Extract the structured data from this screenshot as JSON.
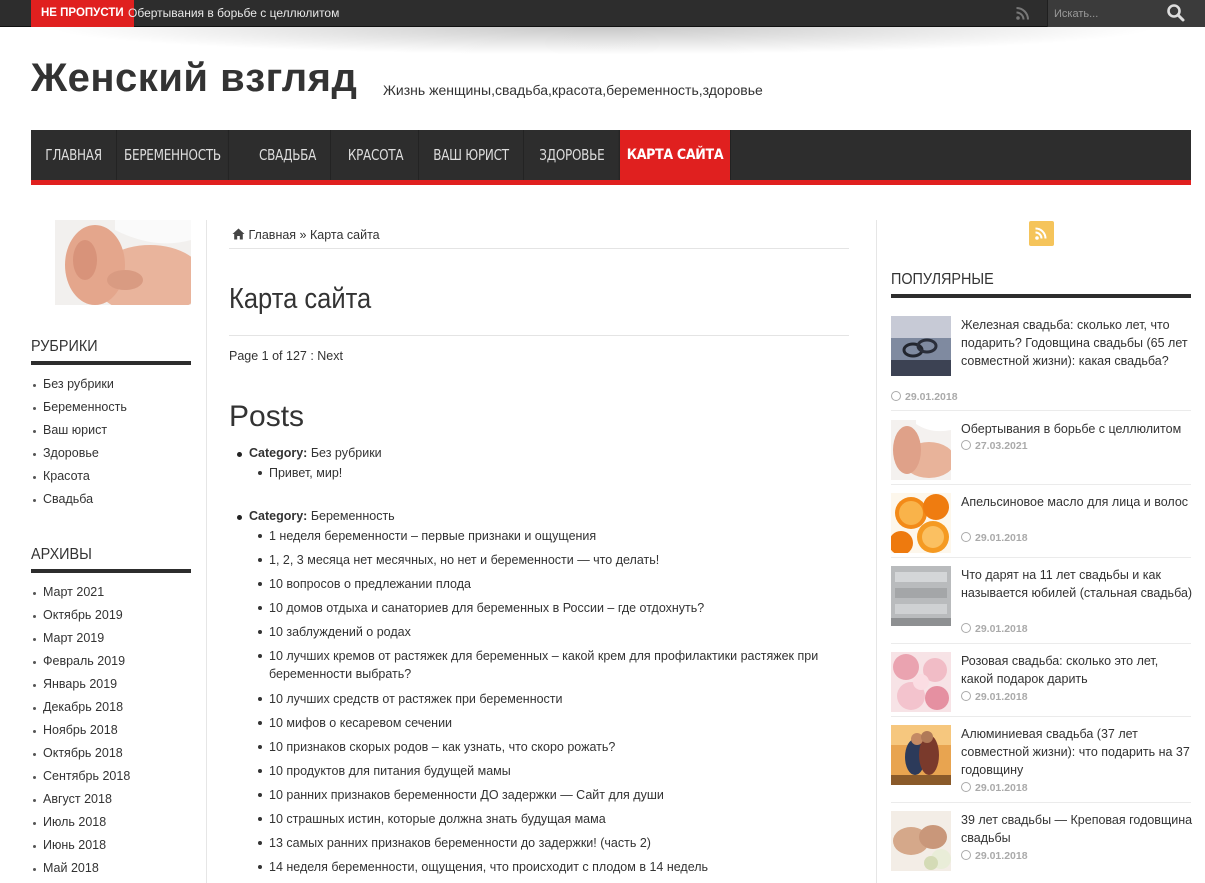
{
  "topbar": {
    "breaking_label": "НЕ ПРОПУСТИ",
    "breaking_text": "Обертывания в борьбе с целлюлитом",
    "search_placeholder": "Искать..."
  },
  "header": {
    "site_title": "Женский взгляд",
    "tagline": "Жизнь женщины,свадьба,красота,беременность,здоровье"
  },
  "nav": {
    "items": [
      "ГЛАВНАЯ",
      "БЕРЕМЕННОСТЬ",
      "СВАДЬБА",
      "КРАСОТА",
      "ВАШ ЮРИСТ",
      "ЗДОРОВЬЕ",
      "КАРТА САЙТА"
    ]
  },
  "left": {
    "rubrics_title": "РУБРИКИ",
    "rubrics": [
      "Без рубрики",
      "Беременность",
      "Ваш юрист",
      "Здоровье",
      "Красота",
      "Свадьба"
    ],
    "archives_title": "АРХИВЫ",
    "archives": [
      "Март 2021",
      "Октябрь 2019",
      "Март 2019",
      "Февраль 2019",
      "Январь 2019",
      "Декабрь 2018",
      "Ноябрь 2018",
      "Октябрь 2018",
      "Сентябрь 2018",
      "Август 2018",
      "Июль 2018",
      "Июнь 2018",
      "Май 2018"
    ]
  },
  "main": {
    "breadcrumb_home": "Главная",
    "breadcrumb_sep": "»",
    "breadcrumb_current": "Карта сайта",
    "page_title": "Карта сайта",
    "pager": "Page 1 of 127 : Next",
    "posts_heading": "Posts",
    "category_label": "Category:",
    "cat1_name": "Без рубрики",
    "cat1_posts": [
      "Привет, мир!"
    ],
    "cat2_name": "Беременность",
    "cat2_posts": [
      "1 неделя беременности – первые признаки и ощущения",
      "1, 2, 3 месяца нет месячных, но нет и беременности — что делать!",
      "10 вопросов о предлежании плода",
      "10 домов отдыха и санаториев для беременных в России – где отдохнуть?",
      "10 заблуждений о родах",
      "10 лучших кремов от растяжек для беременных – какой крем для профилактики растяжек при беременности выбрать?",
      "10 лучших средств от растяжек при беременности",
      "10 мифов о кесаревом сечении",
      "10 признаков скорых родов – как узнать, что скоро рожать?",
      "10 продуктов для питания будущей мамы",
      "10 ранних признаков беременности ДО задержки — Сайт для души",
      "10 страшных истин, которые должна знать будущая мама",
      "13 самых ранних признаков беременности до задержки! (часть 2)",
      "14 неделя беременности, ощущения, что происходит с плодом в 14 недель"
    ]
  },
  "right": {
    "popular_title": "ПОПУЛЯРНЫЕ",
    "items": [
      {
        "title": "Железная свадьба: сколько лет, что подарить? Годовщина свадьбы (65 лет совместной жизни): какая свадьба?",
        "date": "29.01.2018"
      },
      {
        "title": "Обертывания в борьбе с целлюлитом",
        "date": "27.03.2021"
      },
      {
        "title": "Апельсиновое масло для лица и волос",
        "date": "29.01.2018"
      },
      {
        "title": "Что дарят на 11 лет свадьбы и как называется юбилей (стальная свадьба)",
        "date": "29.01.2018"
      },
      {
        "title": "Розовая свадьба: сколько это лет, какой подарок дарить",
        "date": "29.01.2018"
      },
      {
        "title": "Алюминиевая свадьба (37 лет совместной жизни): что подарить на 37 годовщину",
        "date": "29.01.2018"
      },
      {
        "title": "39 лет свадьбы — Креповая годовщина свадьбы",
        "date": "29.01.2018"
      }
    ]
  },
  "colors": {
    "accent": "#e0201f",
    "dark": "#2d2d2d",
    "rss": "#f5c45b"
  }
}
